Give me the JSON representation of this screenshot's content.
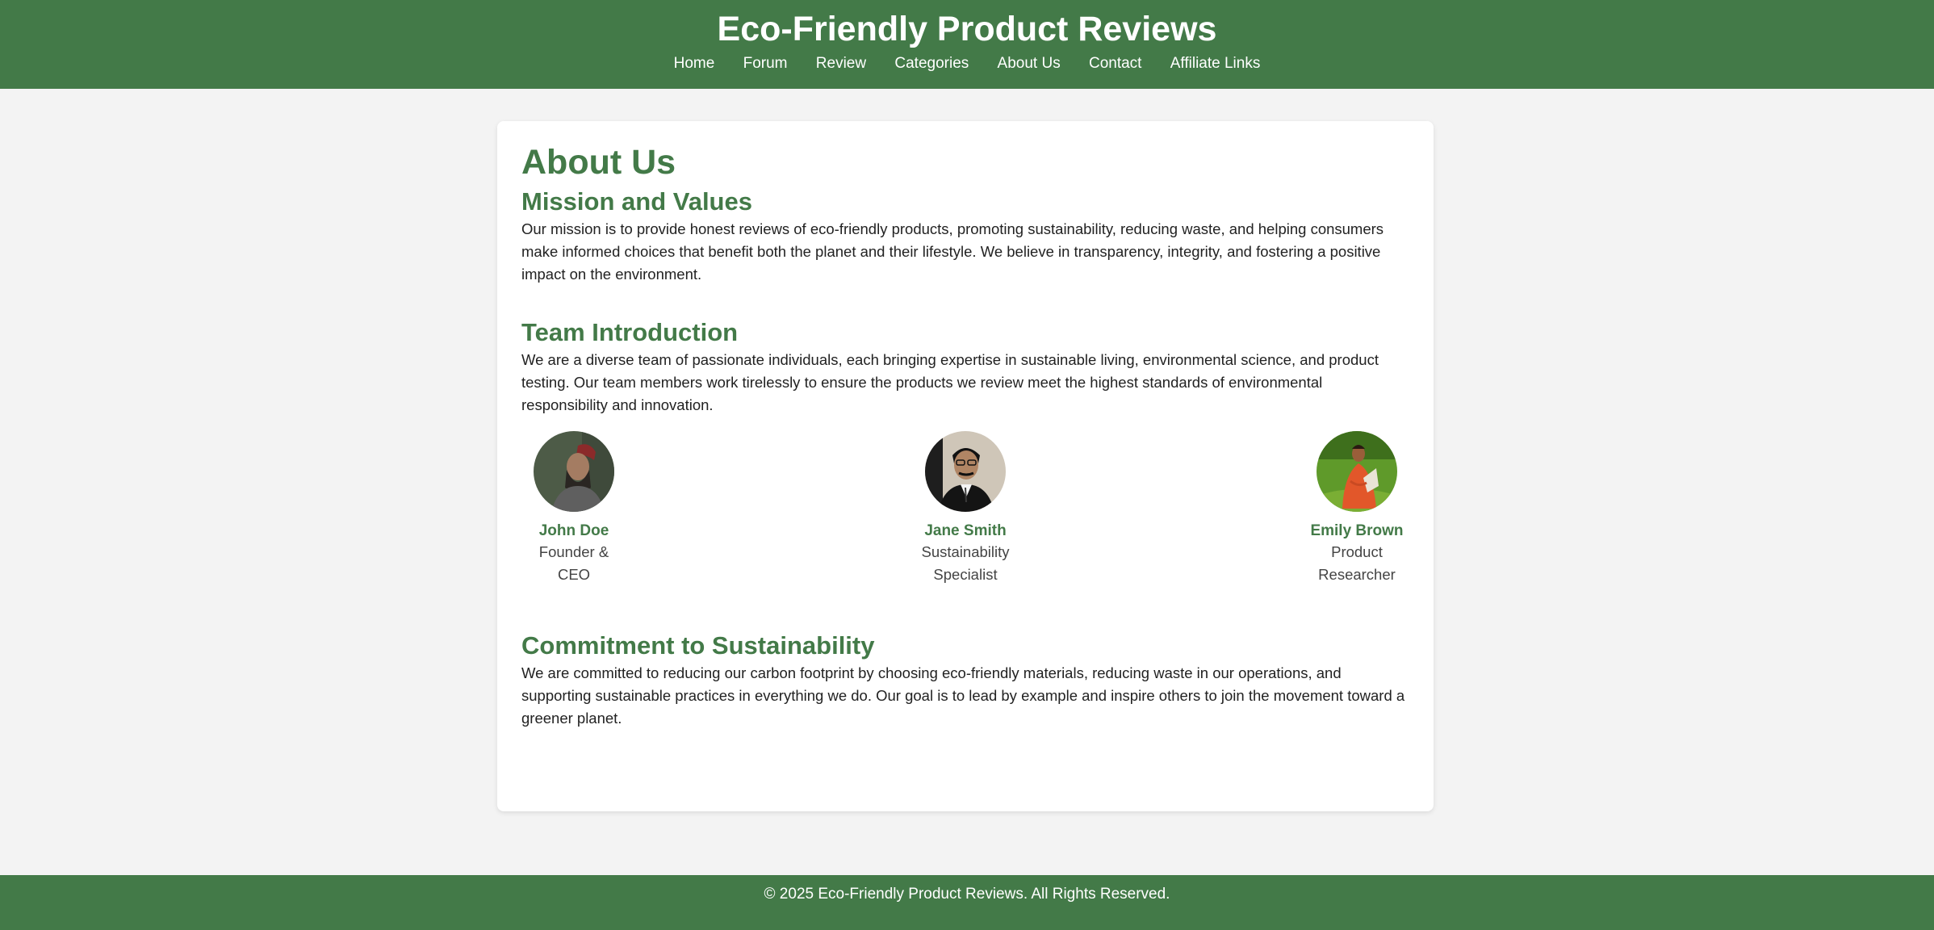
{
  "header": {
    "title": "Eco-Friendly Product Reviews",
    "nav": [
      {
        "label": "Home"
      },
      {
        "label": "Forum"
      },
      {
        "label": "Review"
      },
      {
        "label": "Categories"
      },
      {
        "label": "About Us"
      },
      {
        "label": "Contact"
      },
      {
        "label": "Affiliate Links"
      }
    ]
  },
  "main": {
    "title": "About Us",
    "mission": {
      "heading": "Mission and Values",
      "text": "Our mission is to provide honest reviews of eco-friendly products, promoting sustainability, reducing waste, and helping consumers make informed choices that benefit both the planet and their lifestyle. We believe in transparency, integrity, and fostering a positive impact on the environment."
    },
    "team": {
      "heading": "Team Introduction",
      "text": "We are a diverse team of passionate individuals, each bringing expertise in sustainable living, environmental science, and product testing. Our team members work tirelessly to ensure the products we review meet the highest standards of environmental responsibility and innovation.",
      "members": [
        {
          "name": "John Doe",
          "role": "Founder & CEO"
        },
        {
          "name": "Jane Smith",
          "role": "Sustainability Specialist"
        },
        {
          "name": "Emily Brown",
          "role": "Product Researcher"
        }
      ]
    },
    "commitment": {
      "heading": "Commitment to Sustainability",
      "text": "We are committed to reducing our carbon footprint by choosing eco-friendly materials, reducing waste in our operations, and supporting sustainable practices in everything we do. Our goal is to lead by example and inspire others to join the movement toward a greener planet."
    }
  },
  "footer": {
    "text": "© 2025 Eco-Friendly Product Reviews. All Rights Reserved."
  },
  "colors": {
    "brand_green": "#437a48",
    "page_background": "#f3f3f3",
    "card_background": "#ffffff"
  }
}
